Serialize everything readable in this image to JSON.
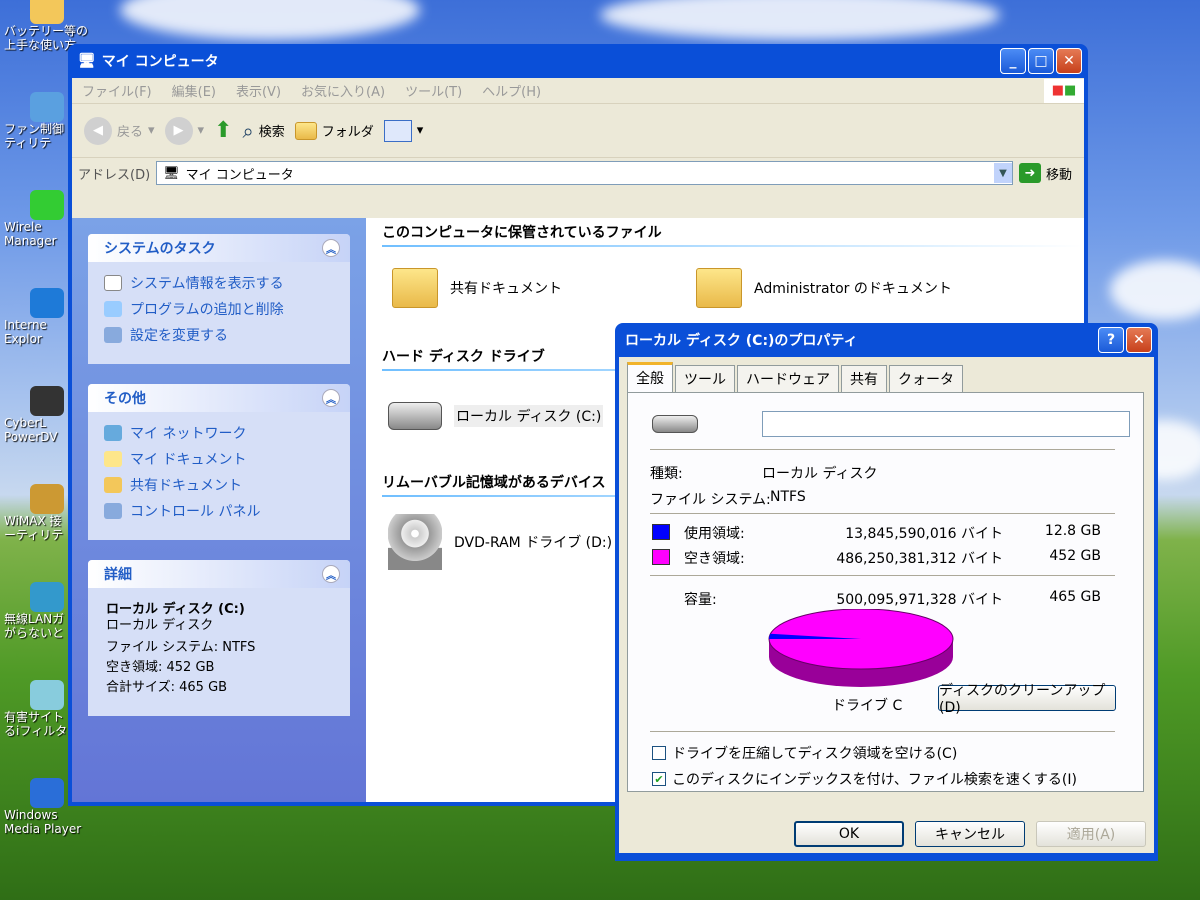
{
  "desktop": {
    "icons": [
      {
        "lines": [
          "バッテリー等の",
          "上手な使い方"
        ],
        "icon": "battery-icon"
      },
      {
        "lines": [
          "ファン制御",
          "ティリテ"
        ],
        "icon": "fan-icon"
      },
      {
        "lines": [
          "Wirele",
          "Manager"
        ],
        "icon": "wireless-icon"
      },
      {
        "lines": [
          "Interne",
          "Explor"
        ],
        "icon": "internet-explorer-icon"
      },
      {
        "lines": [
          "CyberL",
          "PowerDV"
        ],
        "icon": "powerdvd-icon"
      },
      {
        "lines": [
          "WiMAX 接",
          "ーティリテ"
        ],
        "icon": "wimax-icon"
      },
      {
        "lines": [
          "無線LANガ",
          "がらないと"
        ],
        "icon": "wireless-lan-icon"
      },
      {
        "lines": [
          "有害サイト",
          "るiフィルター"
        ],
        "icon": "filter-icon"
      },
      {
        "lines": [
          "Windows",
          "Media Player"
        ],
        "icon": "media-player-icon"
      }
    ]
  },
  "explorer": {
    "title": "マイ コンピュータ",
    "menu": [
      "ファイル(F)",
      "編集(E)",
      "表示(V)",
      "お気に入り(A)",
      "ツール(T)",
      "ヘルプ(H)"
    ],
    "toolbar": {
      "back": "戻る",
      "search": "検索",
      "folders": "フォルダ"
    },
    "address": {
      "label": "アドレス(D)",
      "value": "マイ コンピュータ",
      "go": "移動"
    },
    "system_tasks": {
      "title": "システムのタスク",
      "items": [
        "システム情報を表示する",
        "プログラムの追加と削除",
        "設定を変更する"
      ]
    },
    "other": {
      "title": "その他",
      "items": [
        "マイ ネットワーク",
        "マイ ドキュメント",
        "共有ドキュメント",
        "コントロール パネル"
      ]
    },
    "details": {
      "title": "詳細",
      "name": "ローカル ディスク (C:)",
      "type": "ローカル ディスク",
      "fs": "ファイル システム: NTFS",
      "free": "空き領域: 452 GB",
      "total": "合計サイズ: 465 GB"
    },
    "sections": {
      "stored": "このコンピュータに保管されているファイル",
      "hdd": "ハード ディスク ドライブ",
      "removable": "リムーバブル記憶域があるデバイス"
    },
    "items": {
      "shared_docs": "共有ドキュメント",
      "admin_docs": "Administrator のドキュメント",
      "local_disk": "ローカル ディスク (C:)",
      "dvd": "DVD-RAM ドライブ (D:)"
    }
  },
  "dialog": {
    "title": "ローカル ディスク (C:)のプロパティ",
    "tabs": [
      "全般",
      "ツール",
      "ハードウェア",
      "共有",
      "クォータ"
    ],
    "label_value": "",
    "type_label": "種類:",
    "type_value": "ローカル ディスク",
    "fs_label": "ファイル システム:",
    "fs_value": "NTFS",
    "used": {
      "label": "使用領域:",
      "bytes": "13,845,590,016 バイト",
      "size": "12.8 GB",
      "color": "#0000ff"
    },
    "free": {
      "label": "空き領域:",
      "bytes": "486,250,381,312 バイト",
      "size": "452 GB",
      "color": "#ff00ff"
    },
    "capacity": {
      "label": "容量:",
      "bytes": "500,095,971,328 バイト",
      "size": "465 GB"
    },
    "drive_label": "ドライブ C",
    "cleanup": "ディスクのクリーンアップ(D)",
    "compress": "ドライブを圧縮してディスク領域を空ける(C)",
    "compress_checked": false,
    "index": "このディスクにインデックスを付け、ファイル検索を速くする(I)",
    "index_checked": true,
    "ok": "OK",
    "cancel": "キャンセル",
    "apply": "適用(A)",
    "used_fraction": 0.0277
  }
}
